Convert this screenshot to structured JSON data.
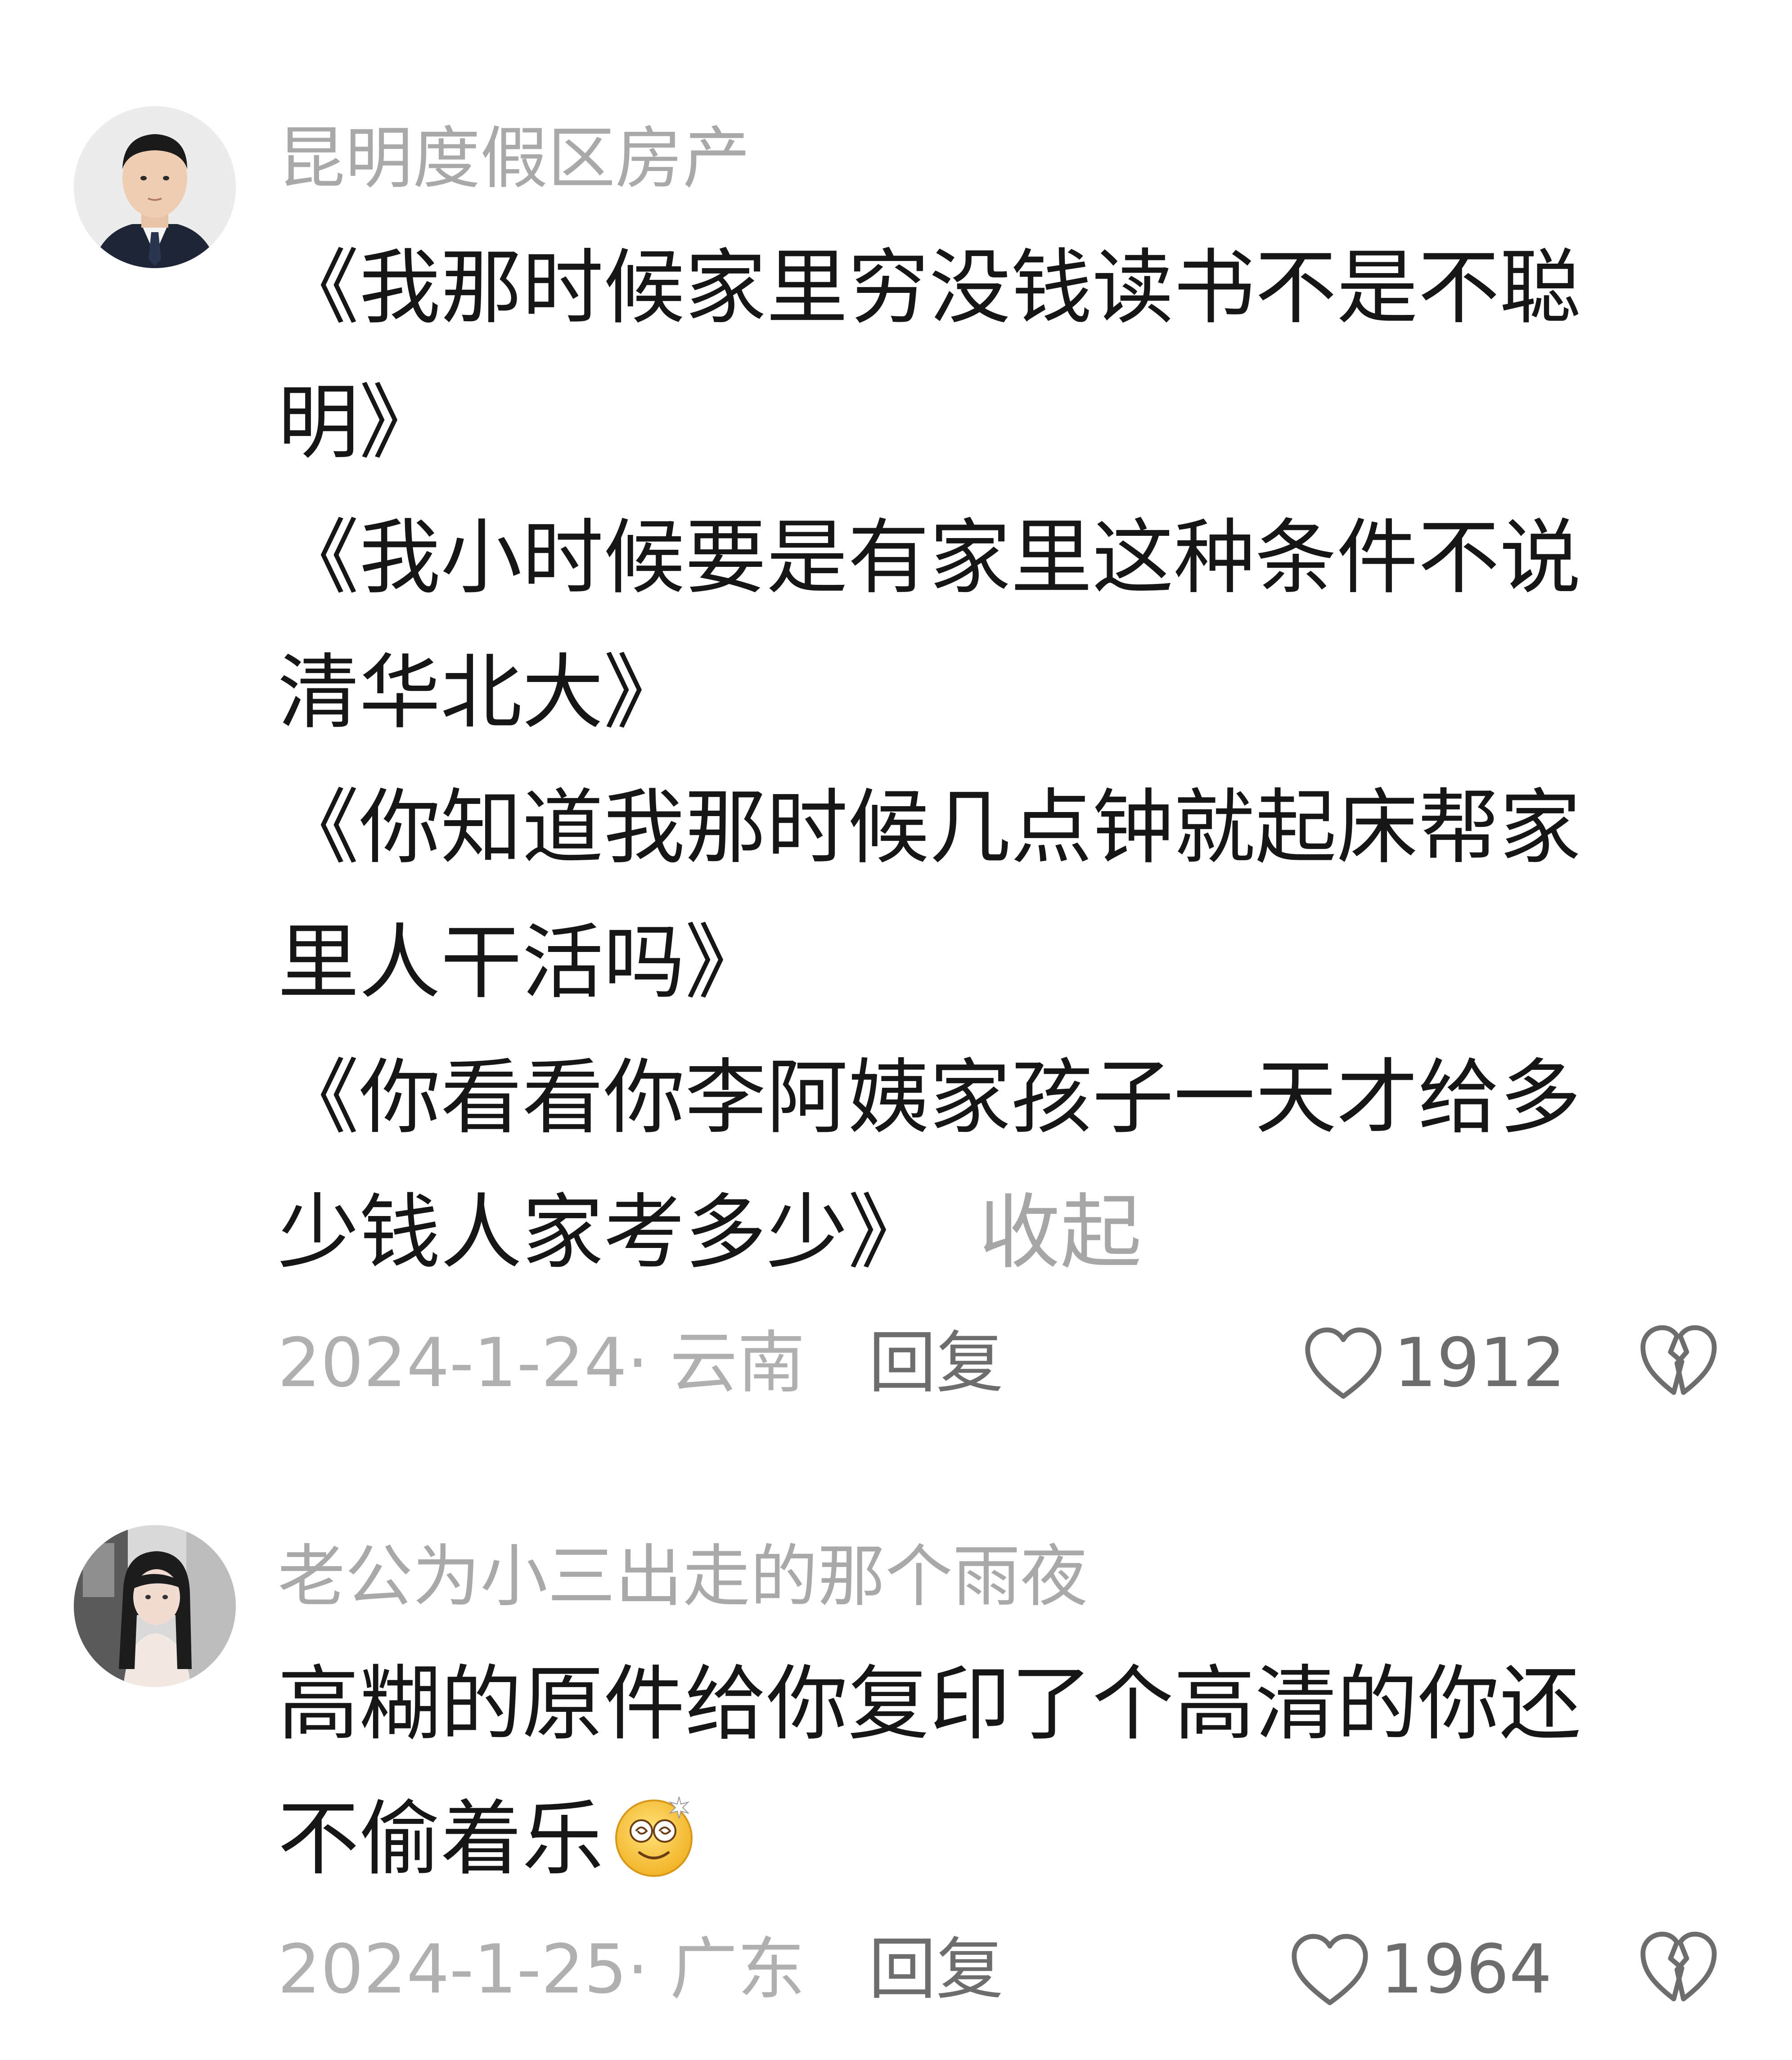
{
  "comments": [
    {
      "username": "昆明度假区房产",
      "lines": [
        "《我那时候家里穷没钱读书不是不聪",
        "明》",
        "《我小时候要是有家里这种条件不说",
        "清华北大》",
        "《你知道我那时候几点钟就起床帮家",
        "里人干活吗》",
        "《你看看你李阿姨家孩子一天才给多",
        "少钱人家考多少》"
      ],
      "collapse_label": "收起",
      "time_location": "2024-1-24· 云南",
      "reply_label": "回复",
      "like_count": "1912",
      "avatar": "man-in-suit-avatar"
    },
    {
      "username": "老公为小三出走的那个雨夜",
      "lines": [
        "高糊的原件给你复印了个高清的你还",
        "不偷着乐"
      ],
      "emoji": "dizzy-smile-emoji",
      "time_location": "2024-1-25· 广东",
      "reply_label": "回复",
      "like_count": "1964",
      "avatar": "long-haired-girl-avatar"
    }
  ],
  "colors": {
    "username": "#a9a9a9",
    "body_text": "#161616",
    "meta": "#b0b0b0",
    "action": "#6d6d6d",
    "background": "#ffffff"
  }
}
